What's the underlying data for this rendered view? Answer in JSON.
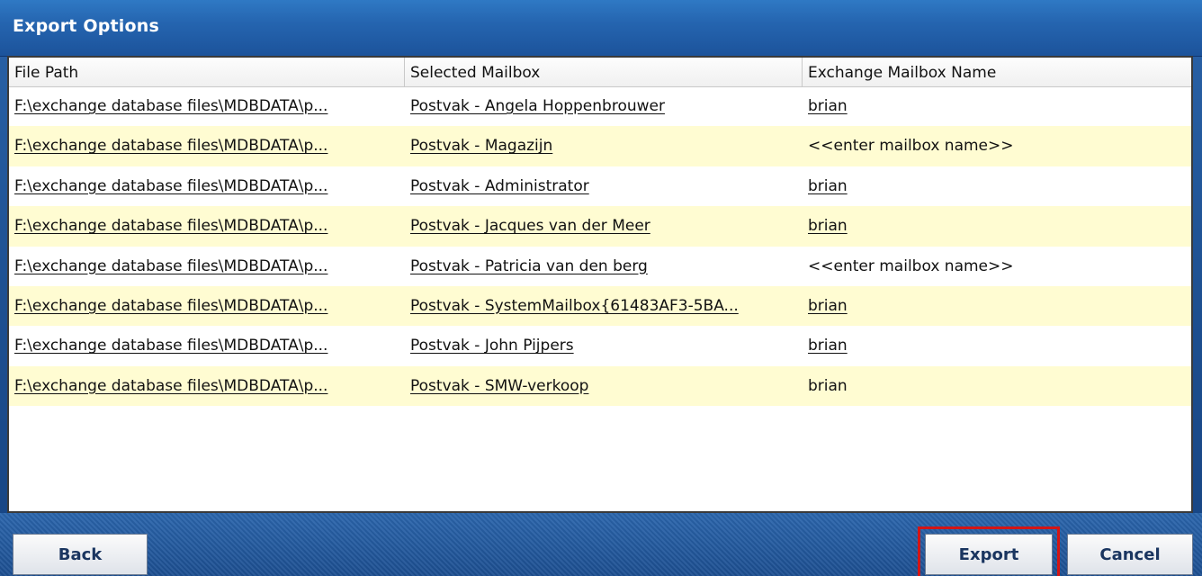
{
  "window": {
    "title": "Export Options"
  },
  "table": {
    "headers": [
      "File Path",
      "Selected Mailbox",
      "Exchange Mailbox Name"
    ],
    "rows": [
      {
        "file_path": "F:\\exchange database files\\MDBDATA\\p...",
        "mailbox": "Postvak - Angela Hoppenbrouwer",
        "exchange_name": "brian"
      },
      {
        "file_path": "F:\\exchange database files\\MDBDATA\\p...",
        "mailbox": "Postvak - Magazijn",
        "exchange_name": "<<enter mailbox name>>"
      },
      {
        "file_path": "F:\\exchange database files\\MDBDATA\\p...",
        "mailbox": "Postvak - Administrator",
        "exchange_name": "brian"
      },
      {
        "file_path": "F:\\exchange database files\\MDBDATA\\p...",
        "mailbox": "Postvak - Jacques van der Meer",
        "exchange_name": "brian"
      },
      {
        "file_path": "F:\\exchange database files\\MDBDATA\\p...",
        "mailbox": "Postvak - Patricia van den berg",
        "exchange_name": "<<enter mailbox name>>"
      },
      {
        "file_path": "F:\\exchange database files\\MDBDATA\\p...",
        "mailbox": "Postvak - SystemMailbox{61483AF3-5BA...",
        "exchange_name": "brian"
      },
      {
        "file_path": "F:\\exchange database files\\MDBDATA\\p...",
        "mailbox": "Postvak - John Pijpers",
        "exchange_name": "brian"
      },
      {
        "file_path": "F:\\exchange database files\\MDBDATA\\p...",
        "mailbox": "Postvak - SMW-verkoop",
        "exchange_name": "brian"
      }
    ]
  },
  "buttons": {
    "back": "Back",
    "export": "Export",
    "cancel": "Cancel"
  },
  "colors": {
    "title_bar": "#2565b0",
    "row_alt": "#fffcd2",
    "highlight": "#d31515"
  }
}
